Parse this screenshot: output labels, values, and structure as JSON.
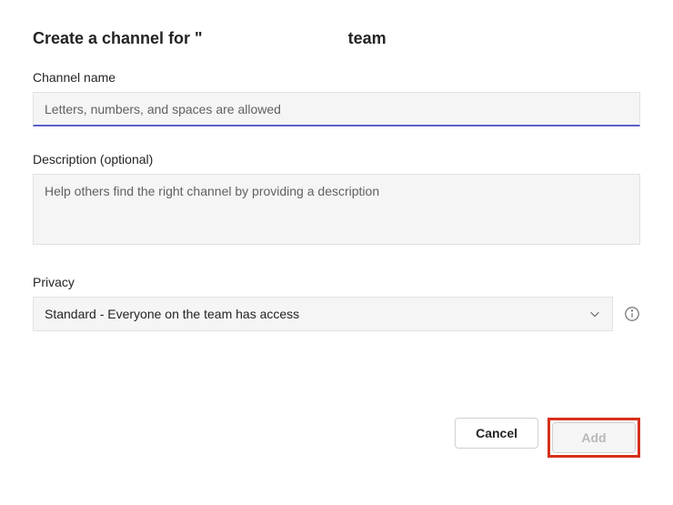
{
  "dialog": {
    "title_prefix": "Create a channel for \"",
    "title_suffix": "team"
  },
  "fields": {
    "channel_name": {
      "label": "Channel name",
      "placeholder": "Letters, numbers, and spaces are allowed",
      "value": ""
    },
    "description": {
      "label": "Description (optional)",
      "placeholder": "Help others find the right channel by providing a description",
      "value": ""
    },
    "privacy": {
      "label": "Privacy",
      "selected": "Standard - Everyone on the team has access"
    }
  },
  "buttons": {
    "cancel": "Cancel",
    "add": "Add"
  }
}
